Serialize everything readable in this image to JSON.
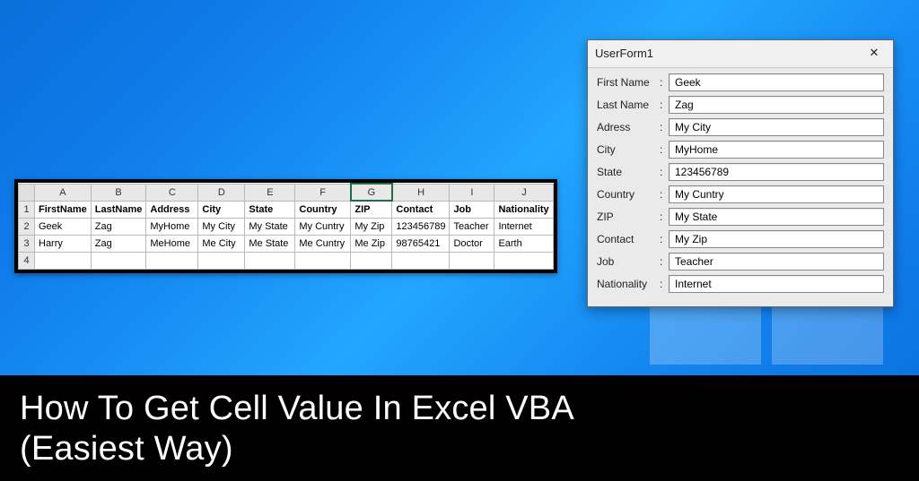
{
  "sheet": {
    "column_letters": [
      "A",
      "B",
      "C",
      "D",
      "E",
      "F",
      "G",
      "H",
      "I",
      "J"
    ],
    "row_numbers": [
      "1",
      "2",
      "3",
      "4"
    ],
    "selected_column": "G",
    "headers": [
      "FirstName",
      "LastName",
      "Address",
      "City",
      "State",
      "Country",
      "ZIP",
      "Contact",
      "Job",
      "Nationality"
    ],
    "rows": [
      [
        "Geek",
        "Zag",
        "MyHome",
        "My City",
        "My State",
        "My Cuntry",
        "My Zip",
        "123456789",
        "Teacher",
        "Internet"
      ],
      [
        "Harry",
        "Zag",
        "MeHome",
        "Me City",
        "Me State",
        "Me Cuntry",
        "Me Zip",
        "98765421",
        "Doctor",
        "Earth"
      ],
      [
        "",
        "",
        "",
        "",
        "",
        "",
        "",
        "",
        "",
        ""
      ]
    ]
  },
  "userform": {
    "title": "UserForm1",
    "fields": [
      {
        "label": "First Name",
        "value": "Geek"
      },
      {
        "label": "Last Name",
        "value": "Zag"
      },
      {
        "label": "Adress",
        "value": "My City"
      },
      {
        "label": "City",
        "value": "MyHome"
      },
      {
        "label": "State",
        "value": "123456789"
      },
      {
        "label": "Country",
        "value": "My Cuntry"
      },
      {
        "label": "ZIP",
        "value": "My State"
      },
      {
        "label": "Contact",
        "value": "My Zip"
      },
      {
        "label": "Job",
        "value": "Teacher"
      },
      {
        "label": "Nationality",
        "value": "Internet"
      }
    ]
  },
  "caption": {
    "line1": "How To Get Cell Value In Excel VBA",
    "line2": "(Easiest Way)"
  }
}
